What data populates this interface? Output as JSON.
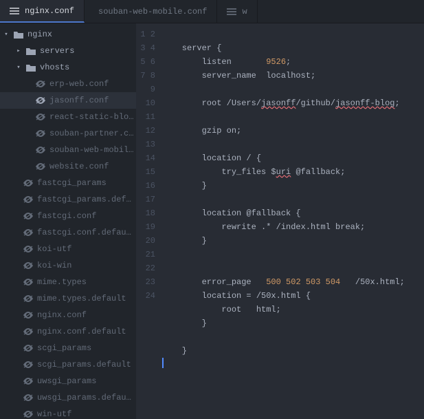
{
  "tabs": [
    {
      "label": "nginx.conf",
      "active": true
    },
    {
      "label": "souban-web-mobile.conf",
      "active": false
    },
    {
      "label": "w",
      "active": false
    }
  ],
  "tree": {
    "root": "nginx",
    "folders": {
      "servers": "servers",
      "vhosts": "vhosts"
    },
    "vhosts_files": [
      "erp-web.conf",
      "jasonff.conf",
      "react-static-blog.con",
      "souban-partner.conf",
      "souban-web-mobile.c",
      "website.conf"
    ],
    "root_files": [
      "fastcgi_params",
      "fastcgi_params.default",
      "fastcgi.conf",
      "fastcgi.conf.default",
      "koi-utf",
      "koi-win",
      "mime.types",
      "mime.types.default",
      "nginx.conf",
      "nginx.conf.default",
      "scgi_params",
      "scgi_params.default",
      "uwsgi_params",
      "uwsgi_params.default",
      "win-utf"
    ]
  },
  "code": {
    "lines": 24,
    "l1": "    server {",
    "l2a": "        listen       ",
    "l2b": "9526",
    "l2c": ";",
    "l3": "        server_name  localhost;",
    "l4": "",
    "l5a": "        root /Users/",
    "l5b": "jasonff",
    "l5c": "/github/",
    "l5d": "jasonff-blog",
    "l5e": ";",
    "l6": "",
    "l7": "        gzip on;",
    "l8": "",
    "l9": "        location / {",
    "l10a": "            try_files $",
    "l10b": "uri",
    "l10c": " @fallback;",
    "l11": "        }",
    "l12": "",
    "l13": "        location @fallback {",
    "l14": "            rewrite .* /index.html break;",
    "l15": "        }",
    "l16": "",
    "l17": "",
    "l18a": "        error_page   ",
    "l18b": "500 502 503 504",
    "l18c": "   /50x.html;",
    "l19": "        location = /50x.html {",
    "l20": "            root   html;",
    "l21": "        }",
    "l22": "",
    "l23": "    }",
    "l24": ""
  }
}
